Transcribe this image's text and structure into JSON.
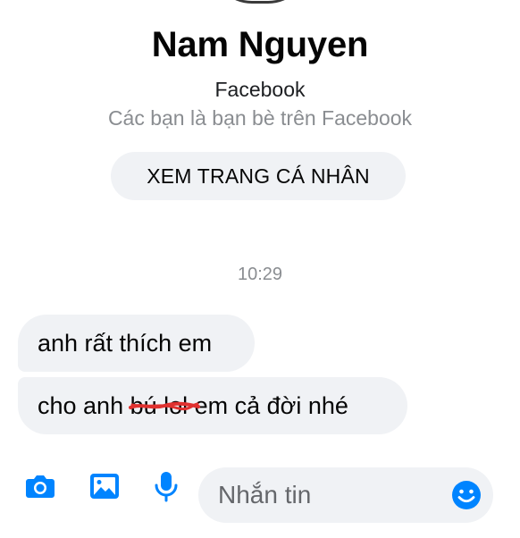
{
  "profile": {
    "name": "Nam Nguyen",
    "platform": "Facebook",
    "relation": "Các bạn là bạn bè trên Facebook",
    "view_profile_label": "XEM TRANG CÁ NHÂN"
  },
  "conversation": {
    "timestamp": "10:29",
    "messages": [
      {
        "text": "anh rất thích em"
      },
      {
        "prefix": "cho anh ",
        "struck": "bú lol",
        "suffix": " em cả đời nhé"
      }
    ]
  },
  "composer": {
    "placeholder": "Nhắn tin",
    "icons": [
      "camera-icon",
      "image-icon",
      "microphone-icon",
      "emoji-icon"
    ]
  },
  "colors": {
    "accent": "#0084ff",
    "bubble": "#f0f2f5",
    "muted_text": "#8a8d91",
    "strike_mark": "#e0312f"
  }
}
